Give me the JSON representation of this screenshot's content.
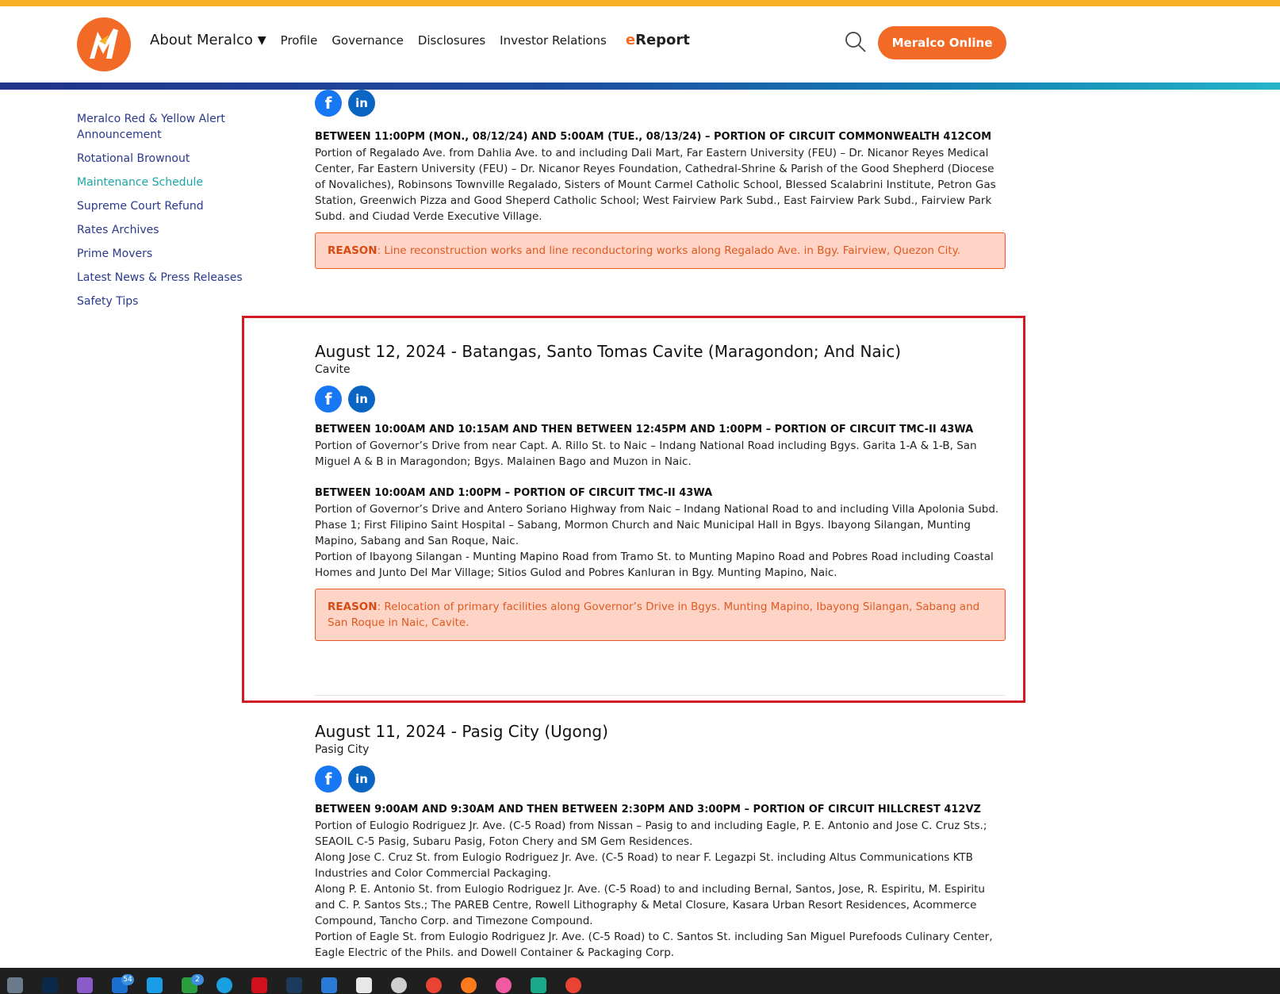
{
  "header": {
    "nav": {
      "about": "About Meralco",
      "profile": "Profile",
      "governance": "Governance",
      "disclosures": "Disclosures",
      "investor_relations": "Investor Relations",
      "ereport_e": "e",
      "ereport_rest": "Report"
    },
    "online_button": "Meralco Online"
  },
  "sidebar": {
    "items": [
      {
        "label": "Meralco Red & Yellow Alert Announcement"
      },
      {
        "label": "Rotational Brownout"
      },
      {
        "label": "Maintenance Schedule"
      },
      {
        "label": "Supreme Court Refund"
      },
      {
        "label": "Rates Archives"
      },
      {
        "label": "Prime Movers"
      },
      {
        "label": "Latest News & Press Releases"
      },
      {
        "label": "Safety Tips"
      }
    ]
  },
  "post1": {
    "circuit": "BETWEEN 11:00PM (MON., 08/12/24) AND 5:00AM (TUE., 08/13/24) – PORTION OF CIRCUIT COMMONWEALTH 412COM",
    "desc": "Portion of Regalado Ave. from Dahlia Ave. to and including Dali Mart, Far Eastern University (FEU) – Dr. Nicanor Reyes Medical Center, Far Eastern University (FEU) – Dr. Nicanor Reyes Foundation, Cathedral-Shrine & Parish of the Good Shepherd (Diocese of Novaliches), Robinsons Townville Regalado, Sisters of Mount Carmel Catholic School, Blessed Scalabrini Institute, Petron Gas Station, Greenwich Pizza and Good Sheperd Catholic School; West Fairview Park Subd., East Fairview Park Subd., Fairview Park Subd. and Ciudad Verde Executive Village.",
    "reason_label": "REASON",
    "reason_text": ": Line reconstruction works and line reconductoring works along Regalado Ave. in Bgy. Fairview, Quezon City."
  },
  "post2": {
    "title": "August 12, 2024 - Batangas, Santo Tomas Cavite (Maragondon; And Naic)",
    "category": "Cavite",
    "circuit1": "BETWEEN 10:00AM AND 10:15AM AND THEN BETWEEN 12:45PM AND 1:00PM – PORTION OF CIRCUIT TMC-II 43WA",
    "desc1": "Portion of Governor’s Drive from near Capt. A. Rillo St. to Naic – Indang National Road including Bgys. Garita 1-A & 1-B, San Miguel A & B in Maragondon; Bgys. Malainen Bago and Muzon in Naic.",
    "circuit2": "BETWEEN 10:00AM AND 1:00PM – PORTION OF CIRCUIT TMC-II 43WA",
    "desc2a": "Portion of Governor’s Drive and Antero Soriano Highway from Naic – Indang National Road to and including Villa Apolonia Subd. Phase 1; First Filipino Saint Hospital – Sabang, Mormon Church and Naic Municipal Hall in Bgys. Ibayong Silangan, Munting Mapino, Sabang and San Roque, Naic.",
    "desc2b": "Portion of Ibayong Silangan - Munting Mapino Road from Tramo St. to Munting Mapino Road and Pobres Road including Coastal Homes and Junto Del Mar Village; Sitios Gulod and Pobres Kanluran in Bgy. Munting Mapino, Naic.",
    "reason_label": "REASON",
    "reason_text": ": Relocation of primary facilities along Governor’s Drive in Bgys. Munting Mapino, Ibayong Silangan, Sabang and San Roque in Naic, Cavite."
  },
  "post3": {
    "title": "August 11, 2024 - Pasig City (Ugong)",
    "category": "Pasig City",
    "circuit": "BETWEEN 9:00AM AND 9:30AM AND THEN BETWEEN 2:30PM AND 3:00PM – PORTION OF CIRCUIT HILLCREST 412VZ",
    "desc_a": "Portion of Eulogio Rodriguez Jr. Ave. (C-5 Road) from Nissan – Pasig to and including Eagle, P. E. Antonio and Jose C. Cruz Sts.; SEAOIL C-5 Pasig, Subaru Pasig, Foton Chery and SM Gem Residences.",
    "desc_b": "Along Jose C. Cruz St. from Eulogio Rodriguez Jr. Ave. (C-5 Road) to near F. Legazpi St. including Altus Communications KTB Industries and Color Commercial Packaging.",
    "desc_c": "Along P. E. Antonio St. from Eulogio Rodriguez Jr. Ave. (C-5 Road) to and including Bernal, Santos, Jose, R. Espiritu, M. Espiritu and C. P. Santos Sts.; The PAREB Centre, Rowell Lithography & Metal Closure, Kasara Urban Resort Residences, Acommerce Compound, Tancho Corp. and Timezone Compound.",
    "desc_d": "Portion of Eagle St. from Eulogio Rodriguez Jr. Ave. (C-5 Road) to C. Santos St. including San Miguel Purefoods Culinary Center, Eagle Electric of the Phils. and Dowell Container & Packaging Corp."
  },
  "taskbar": {
    "badge_mail": "54",
    "badge_xbox": "2"
  },
  "colors": {
    "brand_orange": "#f26a25",
    "top_strip": "#f6b129",
    "highlight_box": "#d01b24",
    "sidebar_link": "#2a3a8c",
    "sidebar_active": "#1ba6a6"
  }
}
